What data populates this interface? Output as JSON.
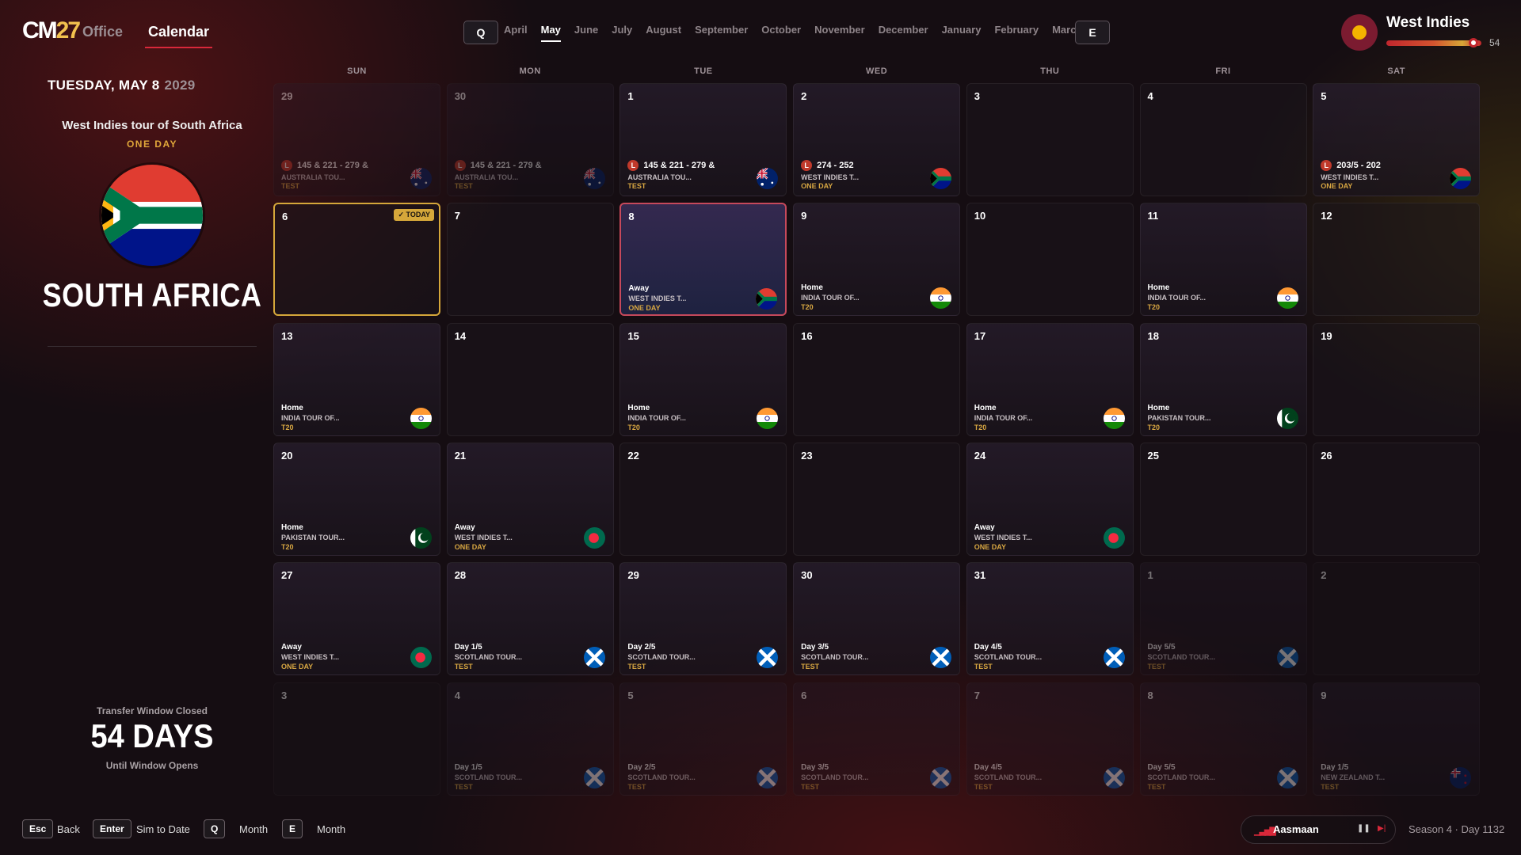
{
  "header": {
    "logo_a": "CM",
    "logo_b": "27",
    "office": "Office",
    "calendar": "Calendar",
    "q": "Q",
    "e": "E",
    "months": [
      "April",
      "May",
      "June",
      "July",
      "August",
      "September",
      "October",
      "November",
      "December",
      "January",
      "February",
      "March"
    ],
    "active_month": "May",
    "team": "West Indies",
    "team_rating": "54",
    "team_bar_fraction": 0.93
  },
  "sidebar": {
    "date": "TUESDAY, MAY 8",
    "year": "2029",
    "tour": "West Indies tour of South Africa",
    "format": "ONE DAY",
    "country": "SOUTH AFRICA",
    "tw_title": "Transfer Window Closed",
    "tw_days": "54 DAYS",
    "tw_sub": "Until Window Opens"
  },
  "weekdays": [
    "SUN",
    "MON",
    "TUE",
    "WED",
    "THU",
    "FRI",
    "SAT"
  ],
  "today_label": "✓ TODAY",
  "cells": [
    {
      "d": "29",
      "dim": 1,
      "res": "145 & 221 - 279 &",
      "t": "AUSTRALIA TOU...",
      "f": "TEST",
      "flag": "au"
    },
    {
      "d": "30",
      "dim": 1,
      "res": "145 & 221 - 279 &",
      "t": "AUSTRALIA TOU...",
      "f": "TEST",
      "flag": "au"
    },
    {
      "d": "1",
      "res": "145 & 221 - 279 &",
      "t": "AUSTRALIA TOU...",
      "f": "TEST",
      "flag": "au"
    },
    {
      "d": "2",
      "res": "274 - 252",
      "t": "WEST INDIES T...",
      "f": "ONE DAY",
      "flag": "za"
    },
    {
      "d": "3",
      "empty": 1
    },
    {
      "d": "4",
      "empty": 1
    },
    {
      "d": "5",
      "res": "203/5 - 202",
      "t": "WEST INDIES T...",
      "f": "ONE DAY",
      "flag": "za"
    },
    {
      "d": "6",
      "empty": 1,
      "today": 1
    },
    {
      "d": "7",
      "empty": 1
    },
    {
      "d": "8",
      "sel": 1,
      "h": "Away",
      "t": "WEST INDIES T...",
      "f": "ONE DAY",
      "flag": "za"
    },
    {
      "d": "9",
      "h": "Home",
      "t": "INDIA TOUR OF...",
      "f": "T20",
      "flag": "in"
    },
    {
      "d": "10",
      "empty": 1
    },
    {
      "d": "11",
      "h": "Home",
      "t": "INDIA TOUR OF...",
      "f": "T20",
      "flag": "in"
    },
    {
      "d": "12",
      "empty": 1
    },
    {
      "d": "13",
      "h": "Home",
      "t": "INDIA TOUR OF...",
      "f": "T20",
      "flag": "in"
    },
    {
      "d": "14",
      "empty": 1
    },
    {
      "d": "15",
      "h": "Home",
      "t": "INDIA TOUR OF...",
      "f": "T20",
      "flag": "in"
    },
    {
      "d": "16",
      "empty": 1
    },
    {
      "d": "17",
      "h": "Home",
      "t": "INDIA TOUR OF...",
      "f": "T20",
      "flag": "in"
    },
    {
      "d": "18",
      "h": "Home",
      "t": "PAKISTAN TOUR...",
      "f": "T20",
      "flag": "pk"
    },
    {
      "d": "19",
      "empty": 1
    },
    {
      "d": "20",
      "h": "Home",
      "t": "PAKISTAN TOUR...",
      "f": "T20",
      "flag": "pk"
    },
    {
      "d": "21",
      "h": "Away",
      "t": "WEST INDIES T...",
      "f": "ONE DAY",
      "flag": "bd"
    },
    {
      "d": "22",
      "empty": 1
    },
    {
      "d": "23",
      "empty": 1
    },
    {
      "d": "24",
      "h": "Away",
      "t": "WEST INDIES T...",
      "f": "ONE DAY",
      "flag": "bd"
    },
    {
      "d": "25",
      "empty": 1
    },
    {
      "d": "26",
      "empty": 1
    },
    {
      "d": "27",
      "h": "Away",
      "t": "WEST INDIES T...",
      "f": "ONE DAY",
      "flag": "bd"
    },
    {
      "d": "28",
      "h": "Day 1/5",
      "t": "SCOTLAND TOUR...",
      "f": "TEST",
      "flag": "sc"
    },
    {
      "d": "29",
      "h": "Day 2/5",
      "t": "SCOTLAND TOUR...",
      "f": "TEST",
      "flag": "sc"
    },
    {
      "d": "30",
      "h": "Day 3/5",
      "t": "SCOTLAND TOUR...",
      "f": "TEST",
      "flag": "sc"
    },
    {
      "d": "31",
      "h": "Day 4/5",
      "t": "SCOTLAND TOUR...",
      "f": "TEST",
      "flag": "sc"
    },
    {
      "d": "1",
      "dim": 1,
      "h": "Day 5/5",
      "t": "SCOTLAND TOUR...",
      "f": "TEST",
      "flag": "sc"
    },
    {
      "d": "2",
      "dim": 1,
      "empty": 1
    },
    {
      "d": "3",
      "dim": 1,
      "empty": 1
    },
    {
      "d": "4",
      "dim": 1,
      "h": "Day 1/5",
      "t": "SCOTLAND TOUR...",
      "f": "TEST",
      "flag": "sc"
    },
    {
      "d": "5",
      "dim": 1,
      "h": "Day 2/5",
      "t": "SCOTLAND TOUR...",
      "f": "TEST",
      "flag": "sc"
    },
    {
      "d": "6",
      "dim": 1,
      "h": "Day 3/5",
      "t": "SCOTLAND TOUR...",
      "f": "TEST",
      "flag": "sc"
    },
    {
      "d": "7",
      "dim": 1,
      "h": "Day 4/5",
      "t": "SCOTLAND TOUR...",
      "f": "TEST",
      "flag": "sc"
    },
    {
      "d": "8",
      "dim": 1,
      "h": "Day 5/5",
      "t": "SCOTLAND TOUR...",
      "f": "TEST",
      "flag": "sc"
    },
    {
      "d": "9",
      "dim": 1,
      "h": "Day 1/5",
      "t": "NEW ZEALAND T...",
      "f": "TEST",
      "flag": "nz"
    }
  ],
  "result_letter": "L",
  "footer": {
    "esc": "Esc",
    "back": "Back",
    "enter": "Enter",
    "sim": "Sim to Date",
    "q": "Q",
    "month1": "Month",
    "e": "E",
    "month2": "Month",
    "song": "Aasmaan",
    "season": "Season 4 · Day 1132"
  }
}
